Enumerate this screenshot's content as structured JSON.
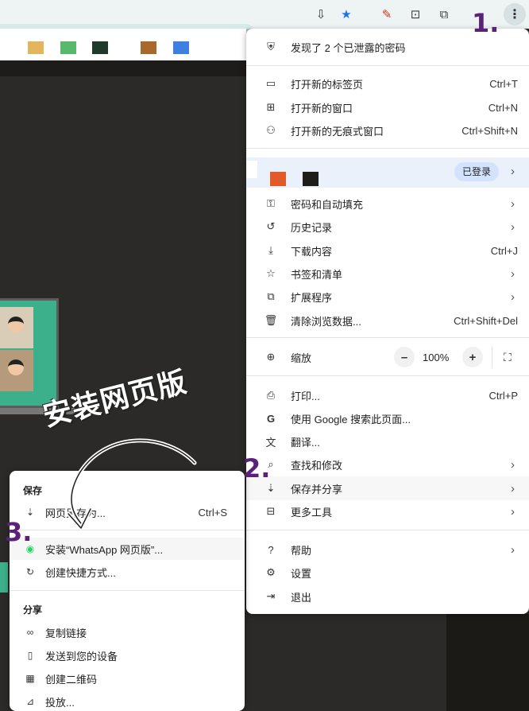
{
  "colors": {
    "accent_purple": "#5a2178",
    "profile_bg": "#eaf1fb",
    "signed_in_pill": "#d3e3fd",
    "star_blue": "#1a73e8",
    "whatsapp_green": "#25d366"
  },
  "toolbar": {
    "icons": [
      "install-icon",
      "star-icon",
      "pen-icon",
      "reader-icon",
      "extension-icon",
      "kebab-menu-icon"
    ]
  },
  "annotations": {
    "step1": "1.",
    "step2": "2.",
    "step3": "3.",
    "title": "安装网页版"
  },
  "menu": {
    "leaked_passwords": "发现了 2 个已泄露的密码",
    "new_tab": {
      "label": "打开新的标签页",
      "shortcut": "Ctrl+T"
    },
    "new_window": {
      "label": "打开新的窗口",
      "shortcut": "Ctrl+N"
    },
    "incognito": {
      "label": "打开新的无痕式窗口",
      "shortcut": "Ctrl+Shift+N"
    },
    "profile": {
      "badge": "已登录"
    },
    "passwords": {
      "label": "密码和自动填充"
    },
    "history": {
      "label": "历史记录"
    },
    "downloads": {
      "label": "下载内容",
      "shortcut": "Ctrl+J"
    },
    "bookmarks": {
      "label": "书签和清单"
    },
    "extensions": {
      "label": "扩展程序"
    },
    "clear_data": {
      "label": "清除浏览数据...",
      "shortcut": "Ctrl+Shift+Del"
    },
    "zoom": {
      "label": "缩放",
      "minus": "–",
      "value": "100%",
      "plus": "+"
    },
    "print": {
      "label": "打印...",
      "shortcut": "Ctrl+P"
    },
    "google_search": {
      "label": "使用 Google 搜索此页面..."
    },
    "translate": {
      "label": "翻译..."
    },
    "find_edit": {
      "label": "查找和修改"
    },
    "save_share": {
      "label": "保存并分享"
    },
    "more_tools": {
      "label": "更多工具"
    },
    "help": {
      "label": "帮助"
    },
    "settings": {
      "label": "设置"
    },
    "exit": {
      "label": "退出"
    }
  },
  "submenu": {
    "save_header": "保存",
    "save_page": {
      "label": "网页另存为...",
      "shortcut": "Ctrl+S"
    },
    "install_whatsapp": {
      "label": "安装“WhatsApp 网页版”..."
    },
    "create_shortcut": {
      "label": "创建快捷方式..."
    },
    "share_header": "分享",
    "copy_link": {
      "label": "复制链接"
    },
    "send_device": {
      "label": "发送到您的设备"
    },
    "qr_code": {
      "label": "创建二维码"
    },
    "cast": {
      "label": "投放..."
    }
  }
}
